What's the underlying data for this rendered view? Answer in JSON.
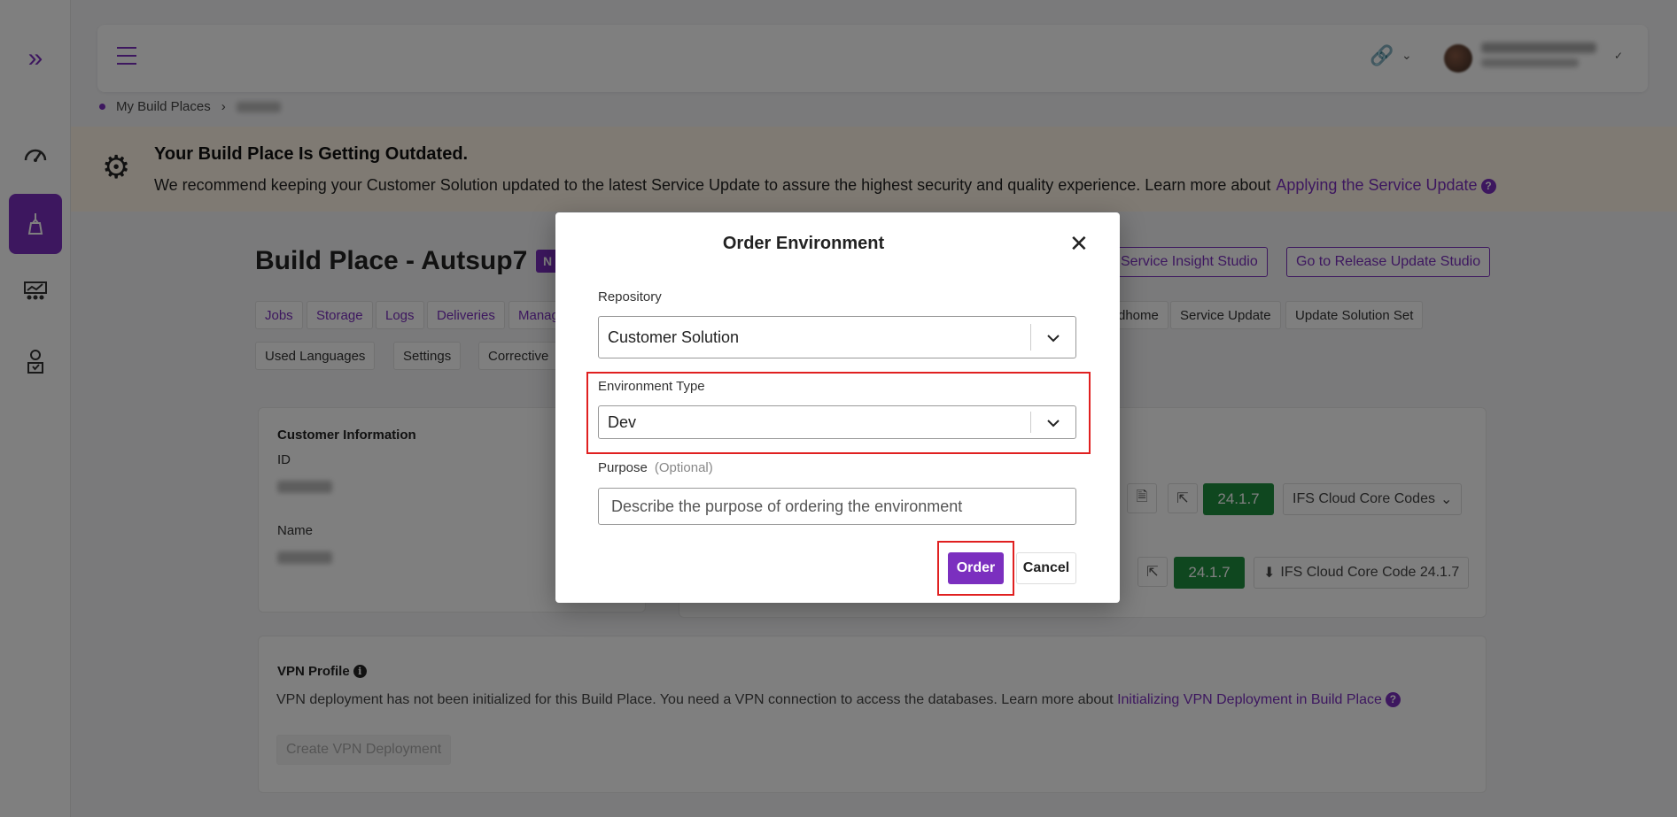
{
  "breadcrumb": {
    "root": "My Build Places"
  },
  "banner": {
    "title": "Your Build Place Is Getting Outdated.",
    "text": "We recommend keeping your Customer Solution updated to the latest Service Update to assure the highest security and quality experience. Learn more about",
    "link": "Applying the Service Update",
    "help": "?"
  },
  "page": {
    "title": "Build Place - Autsup7",
    "badge": "N",
    "buttons": {
      "service_insight": "Service Insight Studio",
      "release_update": "Go to Release Update Studio"
    },
    "tabs_row1": [
      "Jobs",
      "Storage",
      "Logs",
      "Deliveries",
      "Manag",
      "dhome",
      "Service Update",
      "Update Solution Set"
    ],
    "tabs_row2": [
      "Used Languages",
      "Settings",
      "Corrective"
    ]
  },
  "customer_info": {
    "title": "Customer Information",
    "id_label": "ID",
    "name_label": "Name"
  },
  "versions": {
    "row1_version": "24.1.7",
    "row1_code": "IFS Cloud Core Codes",
    "row2_version": "24.1.7",
    "row2_code": "IFS Cloud Core Code 24.1.7"
  },
  "vpn": {
    "title": "VPN Profile",
    "text": "VPN deployment has not been initialized for this Build Place. You need a VPN connection to access the databases. Learn more about",
    "link": "Initializing VPN Deployment in Build Place",
    "create_button": "Create VPN Deployment"
  },
  "modal": {
    "title": "Order Environment",
    "repository_label": "Repository",
    "repository_value": "Customer Solution",
    "env_type_label": "Environment Type",
    "env_type_value": "Dev",
    "purpose_label": "Purpose",
    "purpose_optional": "(Optional)",
    "purpose_placeholder": "Describe the purpose of ordering the environment",
    "order_button": "Order",
    "cancel_button": "Cancel"
  },
  "colors": {
    "accent": "#7b2fbf",
    "success": "#1e8e3e",
    "highlight": "#e02020",
    "banner_bg": "#fff5e6"
  }
}
